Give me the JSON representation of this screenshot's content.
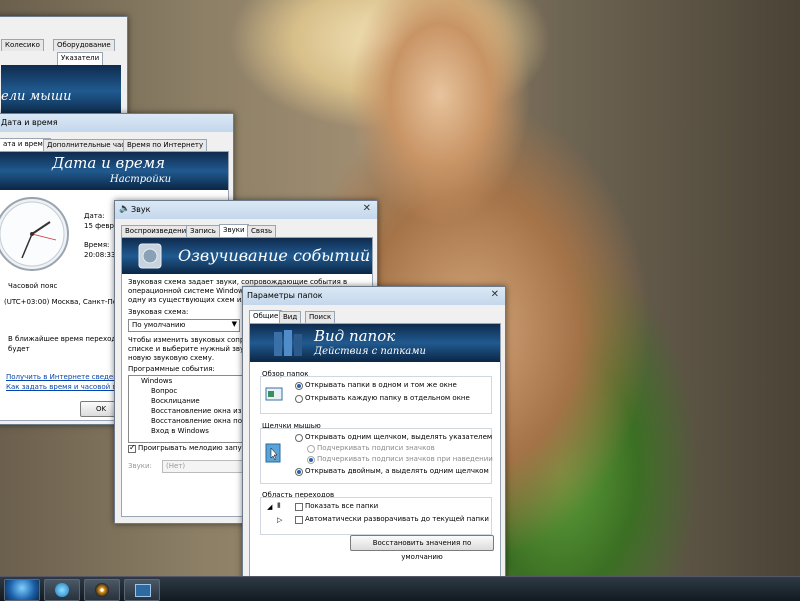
{
  "mouse_win": {
    "tabs": [
      "Колесико",
      "Оборудование"
    ],
    "subtab": "Указатели",
    "banner": "ели мыши"
  },
  "datetime_win": {
    "title": "Дата и время",
    "tabs": [
      "ата и время",
      "Дополнительные часы",
      "Время по Интернету"
    ],
    "banner_title": "Дата и время",
    "banner_sub": "Настройки",
    "date_label": "Дата:",
    "date_value": "15 февраля",
    "time_label": "Время:",
    "time_value": "20:08:33",
    "tz_label": "Часовой пояс",
    "tz_value": "(UTC+03:00) Москва, Санкт-Петерб",
    "dst_text1": "В ближайшее время перехода на л",
    "dst_text2": "будет",
    "link1": "Получить в Интернете сведения о",
    "link2": "Как задать время и часовой пояс?",
    "ok": "OK"
  },
  "sound_win": {
    "title": "Звук",
    "tabs": [
      "Воспроизведение",
      "Запись",
      "Звуки",
      "Связь"
    ],
    "banner": "Озвучивание событий",
    "desc1": "Звуковая схема задает звуки, сопровождающие события в",
    "desc2": "операционной системе Windows или программах. Выберите",
    "desc3": "одну из существующих схем или с",
    "scheme_label": "Звуковая схема:",
    "scheme_value": "По умолчанию",
    "help1": "Чтобы изменить звуковых сопрово",
    "help2": "списке и выберите нужный звук. ",
    "help3": "новую звуковую схему.",
    "events_label": "Программные события:",
    "events": [
      "Windows",
      "Вопрос",
      "Восклицание",
      "Восстановление окна из",
      "Восстановление окна по",
      "Вход в Windows"
    ],
    "play_startup": "Проигрывать мелодию запуск",
    "sounds_label": "Звуки:",
    "sounds_value": "(Нет)"
  },
  "folder_win": {
    "title": "Параметры папок",
    "tabs": [
      "Общие",
      "Вид",
      "Поиск"
    ],
    "banner_title": "Вид папок",
    "banner_sub": "Действия с папками",
    "group1_title": "Обзор папок",
    "g1_opt1": "Открывать папки в одном и том же окне",
    "g1_opt2": "Открывать каждую папку в отдельном окне",
    "group2_title": "Щелчки мышью",
    "g2_opt1": "Открывать одним щелчком, выделять указателем",
    "g2_sub1": "Подчеркивать подписи значков",
    "g2_sub2": "Подчеркивать подписи значков при наведении",
    "g2_opt2": "Открывать двойным, а выделять одним щелчком",
    "group3_title": "Область переходов",
    "g3_opt1": "Показать все папки",
    "g3_opt2": "Автоматически разворачивать до текущей папки",
    "restore": "Восстановить значения по умолчанию"
  },
  "taskbar": {
    "items": [
      "start-orb",
      "ie-icon",
      "media-player-icon",
      "explorer-icon"
    ]
  }
}
